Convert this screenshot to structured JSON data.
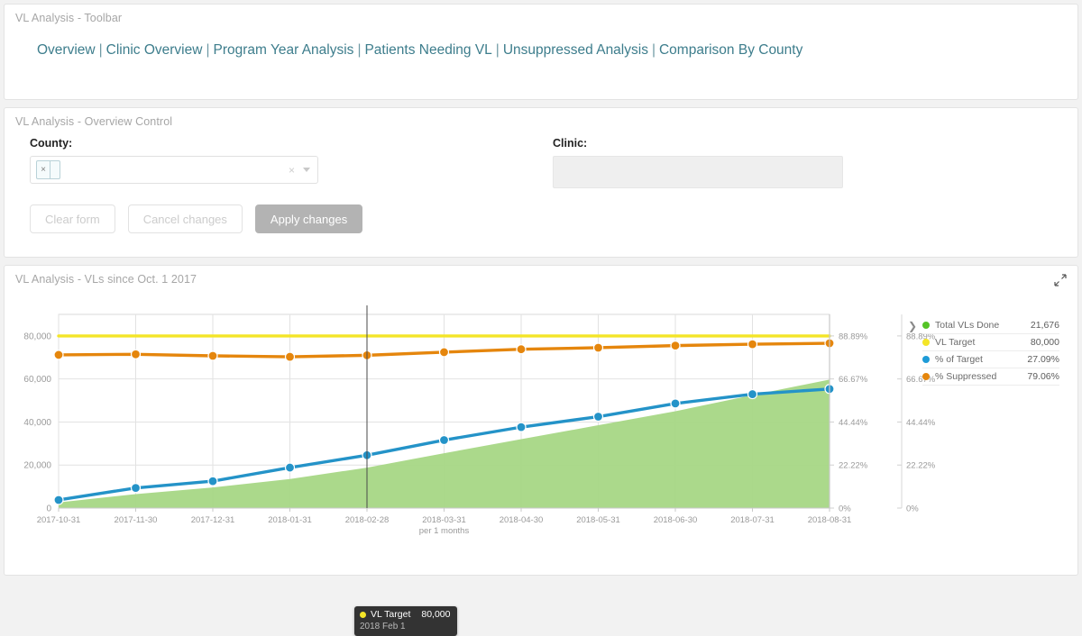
{
  "toolbar": {
    "panel_title": "VL Analysis - Toolbar",
    "separator": "|",
    "links": [
      {
        "label": "Overview"
      },
      {
        "label": "Clinic Overview"
      },
      {
        "label": "Program Year Analysis"
      },
      {
        "label": "Patients Needing VL"
      },
      {
        "label": "Unsuppressed Analysis"
      },
      {
        "label": "Comparison By County"
      }
    ]
  },
  "control": {
    "panel_title": "VL Analysis - Overview Control",
    "county_label": "County:",
    "county_value": "",
    "county_chip_remove": "×",
    "clear_all_icon": "×",
    "clinic_label": "Clinic:",
    "clinic_value": "",
    "buttons": {
      "clear_form": "Clear form",
      "cancel_changes": "Cancel changes",
      "apply_changes": "Apply changes"
    }
  },
  "chart_panel": {
    "panel_title": "VL Analysis - VLs since Oct. 1 2017",
    "expand_icon": "expand-icon",
    "legend_toggle_icon": "chevron-right-icon",
    "tooltip": {
      "series": "VL Target",
      "value": "80,000",
      "date": "2018 Feb 1"
    }
  },
  "chart_data": {
    "type": "line",
    "title": "VL Analysis - VLs since Oct. 1 2017",
    "xlabel": "per 1 months",
    "ylabel": "",
    "grid": true,
    "legend_position": "right",
    "ylim": [
      0,
      90000
    ],
    "y2lim": [
      0,
      100
    ],
    "yticks": [
      0,
      20000,
      40000,
      60000,
      80000
    ],
    "ytick_labels": [
      "0",
      "20,000",
      "40,000",
      "60,000",
      "80,000"
    ],
    "y2ticks": [
      0,
      22.22,
      44.44,
      66.67,
      88.89
    ],
    "y2tick_labels": [
      "0%",
      "22.22%",
      "44.44%",
      "66.67%",
      "88.89%"
    ],
    "x": [
      "2017-10-31",
      "2017-11-30",
      "2017-12-31",
      "2018-01-31",
      "2018-02-28",
      "2018-03-31",
      "2018-04-30",
      "2018-05-31",
      "2018-06-30",
      "2018-07-31",
      "2018-08-31"
    ],
    "series": [
      {
        "name": "Total VLs Done",
        "type": "area",
        "axis": "left",
        "color": "#a6d785",
        "legend_value": "21,676",
        "values": [
          2600,
          6500,
          9600,
          13500,
          18800,
          25500,
          32000,
          38500,
          45000,
          52500,
          59700
        ]
      },
      {
        "name": "VL Target",
        "type": "line",
        "axis": "left",
        "color": "#f4e528",
        "legend_value": "80,000",
        "values": [
          80000,
          80000,
          80000,
          80000,
          80000,
          80000,
          80000,
          80000,
          80000,
          80000,
          80000
        ]
      },
      {
        "name": "% of Target",
        "type": "line",
        "axis": "right",
        "color": "#2493c8",
        "legend_value": "27.09%",
        "values": [
          4.2,
          10.4,
          13.9,
          20.9,
          27.3,
          35.1,
          41.8,
          47.2,
          54.0,
          58.8,
          61.5
        ]
      },
      {
        "name": "% Suppressed",
        "type": "line",
        "axis": "right",
        "color": "#e5860d",
        "legend_value": "79.06%",
        "values": [
          79.1,
          79.4,
          78.6,
          78.1,
          78.9,
          80.5,
          82.0,
          82.8,
          83.9,
          84.6,
          85.1
        ]
      }
    ],
    "legend": [
      {
        "name": "Total VLs Done",
        "value": "21,676",
        "color": "#55c427"
      },
      {
        "name": "VL Target",
        "value": "80,000",
        "color": "#f4e528"
      },
      {
        "name": "% of Target",
        "value": "27.09%",
        "color": "#1e9bd7"
      },
      {
        "name": "% Suppressed",
        "value": "79.06%",
        "color": "#e5860d"
      }
    ]
  }
}
